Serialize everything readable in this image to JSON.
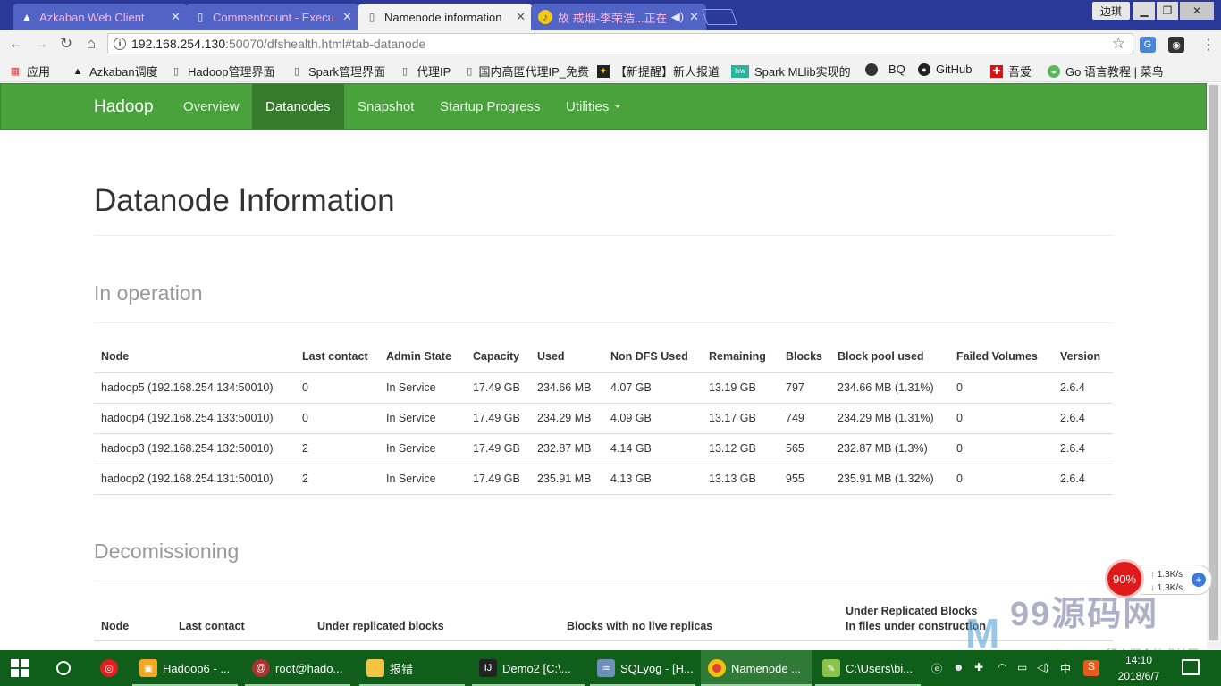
{
  "browser": {
    "tabs": [
      {
        "title": "Azkaban Web Client",
        "icon": "azkaban-icon"
      },
      {
        "title": "Commentcount - Execu",
        "icon": "page-icon"
      },
      {
        "title": "Namenode information",
        "icon": "page-icon",
        "active": true
      },
      {
        "title": "故 戒烟-李荣浩...正在",
        "icon": "music-icon"
      }
    ],
    "user_label": "边琪",
    "address": {
      "host": "192.168.254.130",
      "path": ":50070/dfshealth.html#tab-datanode"
    },
    "bookmarks": [
      {
        "label": "应用",
        "icon": "apps-grid-icon"
      },
      {
        "label": "Azkaban调度",
        "icon": "azkaban-icon"
      },
      {
        "label": "Hadoop管理界面",
        "icon": "page-icon"
      },
      {
        "label": "Spark管理界面",
        "icon": "page-icon"
      },
      {
        "label": "代理IP",
        "icon": "page-icon"
      },
      {
        "label": "国内高匿代理IP_免费",
        "icon": "page-icon"
      },
      {
        "label": "【新提醒】新人报道",
        "icon": "bird-icon"
      },
      {
        "label": "Spark MLlib实现的",
        "icon": "lxw-icon"
      },
      {
        "label": "BQ",
        "icon": "bq-icon"
      },
      {
        "label": "GitHub",
        "icon": "github-icon"
      },
      {
        "label": "吾爱",
        "icon": "wuai-icon"
      },
      {
        "label": "Go 语言教程 | 菜鸟",
        "icon": "runoob-icon"
      }
    ]
  },
  "hadoop": {
    "brand": "Hadoop",
    "nav": [
      "Overview",
      "Datanodes",
      "Snapshot",
      "Startup Progress",
      "Utilities"
    ],
    "active_nav": "Datanodes",
    "page_title": "Datanode Information",
    "in_operation": {
      "heading": "In operation",
      "columns": [
        "Node",
        "Last contact",
        "Admin State",
        "Capacity",
        "Used",
        "Non DFS Used",
        "Remaining",
        "Blocks",
        "Block pool used",
        "Failed Volumes",
        "Version"
      ],
      "rows": [
        [
          "hadoop5 (192.168.254.134:50010)",
          "0",
          "In Service",
          "17.49 GB",
          "234.66 MB",
          "4.07 GB",
          "13.19 GB",
          "797",
          "234.66 MB (1.31%)",
          "0",
          "2.6.4"
        ],
        [
          "hadoop4 (192.168.254.133:50010)",
          "0",
          "In Service",
          "17.49 GB",
          "234.29 MB",
          "4.09 GB",
          "13.17 GB",
          "749",
          "234.29 MB (1.31%)",
          "0",
          "2.6.4"
        ],
        [
          "hadoop3 (192.168.254.132:50010)",
          "2",
          "In Service",
          "17.49 GB",
          "232.87 MB",
          "4.14 GB",
          "13.12 GB",
          "565",
          "232.87 MB (1.3%)",
          "0",
          "2.6.4"
        ],
        [
          "hadoop2 (192.168.254.131:50010)",
          "2",
          "In Service",
          "17.49 GB",
          "235.91 MB",
          "4.13 GB",
          "13.13 GB",
          "955",
          "235.91 MB (1.32%)",
          "0",
          "2.6.4"
        ]
      ]
    },
    "decommissioning": {
      "heading": "Decomissioning",
      "columns": [
        "Node",
        "Last contact",
        "Under replicated blocks",
        "Blocks with no live replicas",
        "Under Replicated Blocks\nIn files under construction"
      ]
    }
  },
  "overlay": {
    "speed_percent": "90%",
    "up_speed": "1.3K/s",
    "down_speed": "1.3K/s",
    "watermark": "99源码网",
    "watermark_sub": "ym.mantefaes.com 稀土掘金技术社区"
  },
  "taskbar": {
    "items": [
      {
        "label": "Hadoop6 - ...",
        "icon": "vmware-icon"
      },
      {
        "label": "root@hado...",
        "icon": "terminal-icon"
      },
      {
        "label": "报错",
        "icon": "folder-icon"
      },
      {
        "label": "Demo2 [C:\\...",
        "icon": "intellij-icon"
      },
      {
        "label": "SQLyog - [H...",
        "icon": "sqlyog-icon"
      },
      {
        "label": "Namenode ...",
        "icon": "chrome-icon",
        "active": true
      },
      {
        "label": "C:\\Users\\bi...",
        "icon": "notepad-icon"
      }
    ],
    "ime": "中",
    "time": "14:10",
    "date": "2018/6/7"
  },
  "colors": {
    "tab_strip": "#2b3a99",
    "hadoop_green": "#4aa23d",
    "taskbar": "#0f5e19"
  }
}
